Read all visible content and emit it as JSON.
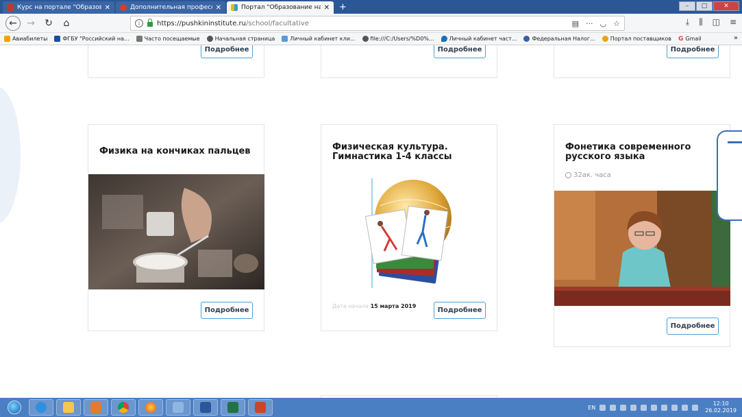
{
  "browser": {
    "tabs": [
      {
        "label": "Курс на портале \"Образован",
        "active": false,
        "icon_color": "#c0392b"
      },
      {
        "label": "Дополнительная профессио",
        "active": false,
        "icon_color": "#d0402e"
      },
      {
        "label": "Портал \"Образование на Рус",
        "active": true,
        "icon_color": "#f2b705"
      }
    ],
    "new_tab": "+",
    "url_host": "https://pushkininstitute.ru",
    "url_path": "/school/facultative",
    "bookmarks": [
      {
        "label": "Авиабилеты",
        "color": "#f0a500"
      },
      {
        "label": "ФГБУ \"Российский на...",
        "color": "#1a4fa0"
      },
      {
        "label": "Часто посещаемые",
        "color": "#777777"
      },
      {
        "label": "Начальная страница",
        "color": "#555555"
      },
      {
        "label": "Личный кабинет кли...",
        "color": "#5a9bd5"
      },
      {
        "label": "file:///C:/Users/%D0%...",
        "color": "#555555"
      },
      {
        "label": "Личный кабинет част...",
        "color": "#1f6fb8"
      },
      {
        "label": "Федеральная Налог...",
        "color": "#3b5fa8"
      },
      {
        "label": "Портал поставщиков",
        "color": "#e8a317"
      },
      {
        "label": "Gmail",
        "color": "#db4437"
      }
    ],
    "bookmarks_more": "»"
  },
  "top_row": {
    "buttons": [
      "Подробнее",
      "Подробнее",
      "Подробнее"
    ]
  },
  "cards": [
    {
      "title": "Физика на кончиках пальцев",
      "button": "Подробнее"
    },
    {
      "title": "Физическая культура. Гимнастика 1-4 классы",
      "start_label": "Дата начала",
      "start_date": "15 марта 2019",
      "button": "Подробнее"
    },
    {
      "title": "Фонетика современного русского языка",
      "hours": "32ак. часа",
      "button": "Подробнее"
    }
  ],
  "taskbar": {
    "lang": "EN",
    "time": "12:10",
    "date": "26.02.2019"
  }
}
